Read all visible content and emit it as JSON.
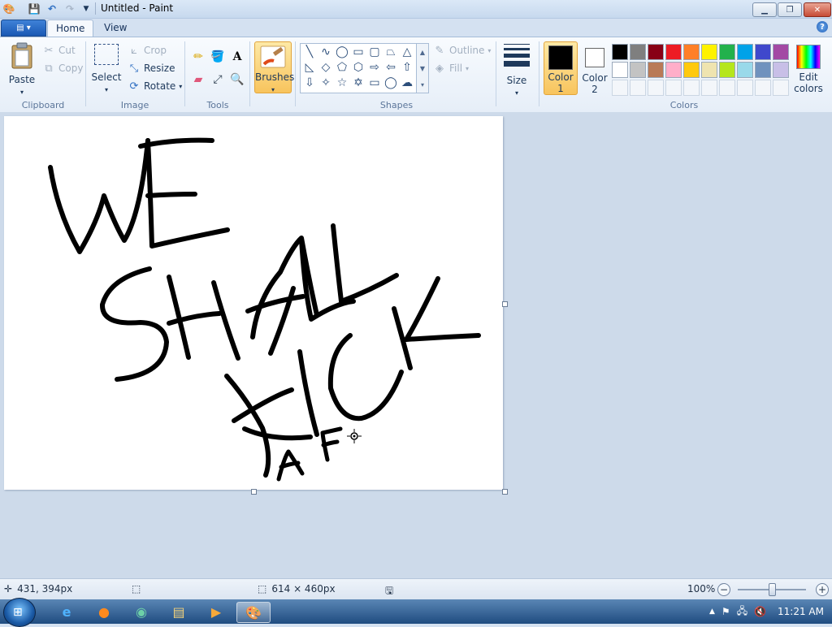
{
  "window": {
    "title": "Untitled - Paint"
  },
  "tabs": [
    {
      "label": "Home"
    },
    {
      "label": "View"
    }
  ],
  "clipboard": {
    "group_label": "Clipboard",
    "paste": "Paste",
    "cut": "Cut",
    "copy": "Copy"
  },
  "image": {
    "group_label": "Image",
    "select": "Select",
    "crop": "Crop",
    "resize": "Resize",
    "rotate": "Rotate"
  },
  "tools": {
    "group_label": "Tools"
  },
  "brushes": {
    "label": "Brushes"
  },
  "shapes": {
    "group_label": "Shapes",
    "outline": "Outline",
    "fill": "Fill"
  },
  "size": {
    "label": "Size"
  },
  "colors": {
    "group_label": "Colors",
    "color1_line1": "Color",
    "color1_line2": "1",
    "color2_line1": "Color",
    "color2_line2": "2",
    "edit_line1": "Edit",
    "edit_line2": "colors",
    "color1": "#000000",
    "color2": "#ffffff",
    "palette_row1": [
      "#000000",
      "#7f7f7f",
      "#880015",
      "#ed1c24",
      "#ff7f27",
      "#fff200",
      "#22b14c",
      "#00a2e8",
      "#3f48cc",
      "#a349a4"
    ],
    "palette_row2": [
      "#ffffff",
      "#c3c3c3",
      "#b97a57",
      "#ffaec9",
      "#ffc90e",
      "#efe4b0",
      "#b5e61d",
      "#99d9ea",
      "#7092be",
      "#c8bfe7"
    ]
  },
  "canvas": {
    "drawing_text": [
      "WE",
      "SHALL",
      "KICK",
      "AF"
    ]
  },
  "status": {
    "cursor_pos": "431, 394px",
    "image_size": "614 × 460px",
    "zoom": "100%"
  },
  "taskbar": {
    "clock": "11:21 AM"
  }
}
